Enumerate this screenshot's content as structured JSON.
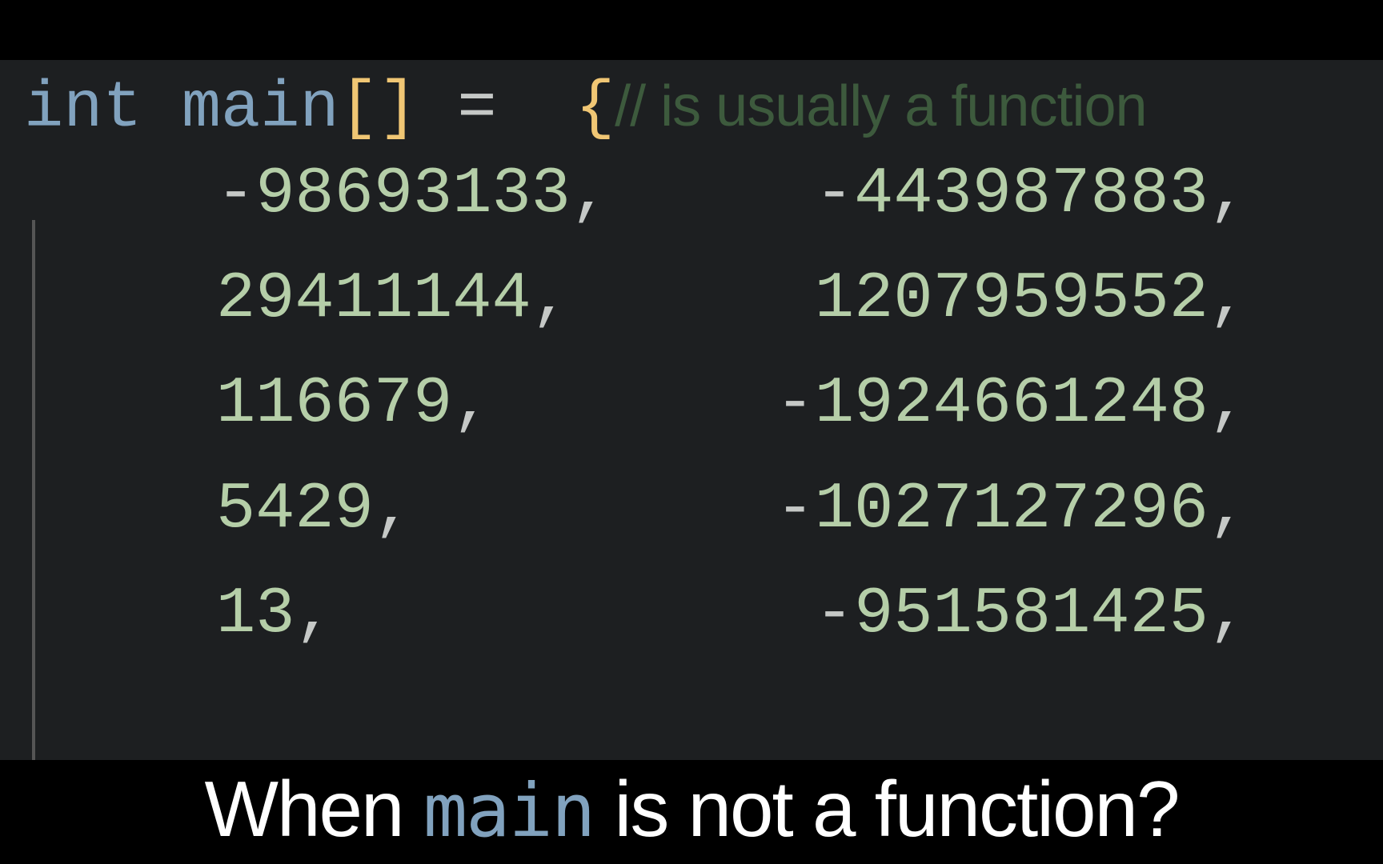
{
  "code": {
    "type_keyword": "int",
    "identifier": "main",
    "brackets": "[]",
    "equals": " = ",
    "open_brace": "{",
    "comment": "// is usually a function",
    "rows": [
      {
        "a": "-98693133",
        "b": "-443987883"
      },
      {
        "a": "29411144",
        "b": "1207959552"
      },
      {
        "a": "116679",
        "b": "-1924661248"
      },
      {
        "a": "5429",
        "b": "-1027127296"
      },
      {
        "a": "13",
        "b": "-951581425"
      }
    ]
  },
  "caption": {
    "pre": "When ",
    "mono": "main",
    "post": " is not a function?"
  }
}
